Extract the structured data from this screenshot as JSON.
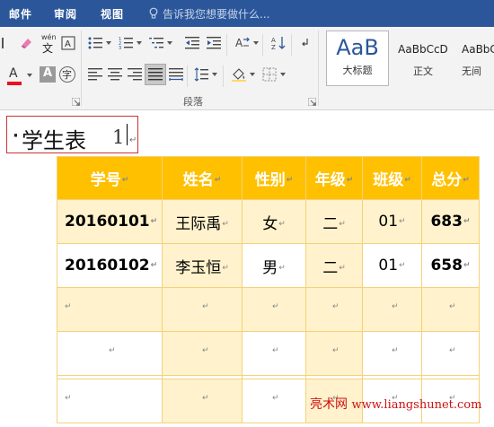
{
  "ribbon_tabs": [
    "邮件",
    "审阅",
    "视图"
  ],
  "tell_me": "告诉我您想要做什么...",
  "font_group": {
    "phonetic_label": "wén",
    "phonetic_char": "文",
    "enclose_char": "字",
    "char_shading_char": "A",
    "font_color_char": "A",
    "font_color_accent": "#e81123"
  },
  "paragraph_group_label": "段落",
  "styles": [
    {
      "sample": "AaB",
      "name": "大标题"
    },
    {
      "sample": "AaBbCcD",
      "name": "正文"
    },
    {
      "sample": "AaBbC",
      "name": "无间"
    }
  ],
  "document": {
    "heading": "学生表",
    "heading_number": "1",
    "paragraph_mark": "↵",
    "table": {
      "headers": [
        "学号",
        "姓名",
        "性别",
        "年级",
        "班级",
        "总分"
      ],
      "rows": [
        [
          "20160101",
          "王际禹",
          "女",
          "二",
          "01",
          "683"
        ],
        [
          "20160102",
          "李玉恒",
          "男",
          "二",
          "01",
          "658"
        ]
      ]
    },
    "watermark_cn": "亮术网",
    "watermark_site": "www.liangshunet.com"
  },
  "colors": {
    "tab_bar": "#2b579a",
    "table_header": "#ffc000",
    "table_band": "#fff2cc",
    "table_border": "#f4d27a",
    "heading_border": "#cc3333"
  }
}
